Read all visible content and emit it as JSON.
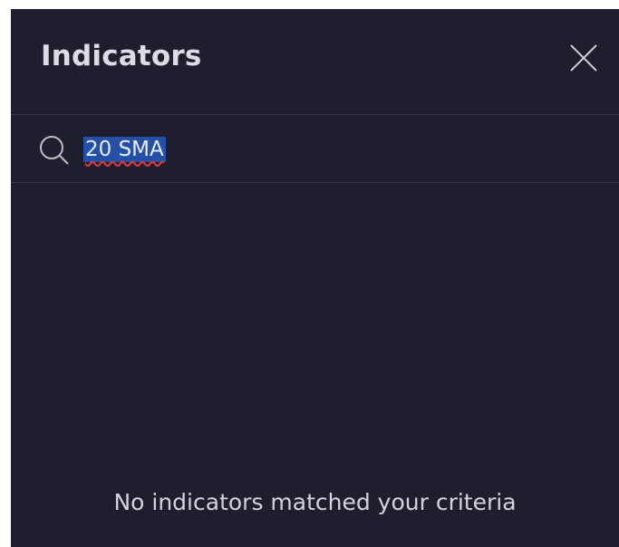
{
  "dialog": {
    "title": "Indicators",
    "close_icon": "close-x-icon"
  },
  "search": {
    "icon": "search-icon",
    "value": "20 SMA"
  },
  "results": {
    "empty_message": "No indicators matched your criteria"
  },
  "colors": {
    "background": "#1f1e2e",
    "divider": "#3a3948",
    "selection": "#2450a8",
    "text": "#d6d6dc"
  }
}
